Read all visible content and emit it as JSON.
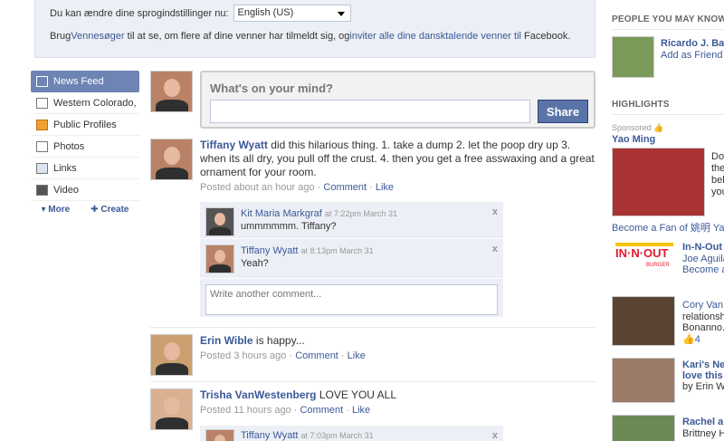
{
  "lang": {
    "label": "Du kan ændre dine sprogindstillinger nu:",
    "selected": "English (US)",
    "info_prefix": "Brug",
    "info_link1": "Vennesøger",
    "info_mid": " til at se, om flere af dine venner har tilmeldt sig, og",
    "info_link2": "inviter alle dine dansktalende venner til",
    "info_suffix": " Facebook."
  },
  "nav": {
    "items": [
      {
        "label": "News Feed",
        "icon": "news-feed-icon"
      },
      {
        "label": "Western Colorado, C",
        "icon": "network-icon"
      },
      {
        "label": "Public Profiles",
        "icon": "public-profiles-icon"
      },
      {
        "label": "Photos",
        "icon": "photos-icon"
      },
      {
        "label": "Links",
        "icon": "links-icon"
      },
      {
        "label": "Video",
        "icon": "video-icon"
      }
    ],
    "more": "▾ More",
    "create": "✚ Create"
  },
  "composer": {
    "prompt": "What's on your mind?",
    "share": "Share"
  },
  "stories": [
    {
      "actor": "Tiffany Wyatt",
      "text": " did this hilarious thing. 1. take a dump 2. let the poop dry up 3. when its all dry, you pull off the crust. 4. then you get a free asswaxing and a great ornament for your room.",
      "time": "Posted about an hour ago",
      "comment": "Comment",
      "like": "Like"
    },
    {
      "actor": "Erin Wible",
      "text": " is happy...",
      "time": "Posted 3 hours ago",
      "comment": "Comment",
      "like": "Like"
    },
    {
      "actor": "Trisha VanWestenberg",
      "text": " LOVE YOU ALL",
      "time": "Posted 11 hours ago",
      "comment": "Comment",
      "like": "Like"
    }
  ],
  "comments": [
    {
      "name": "Kit Maria Markgraf",
      "time": "at 7:22pm March 31",
      "text": "ummmmmm. Tiffany?"
    },
    {
      "name": "Tiffany Wyatt",
      "time": "at 8:13pm March 31",
      "text": "Yeah?"
    }
  ],
  "comments2": [
    {
      "name": "Tiffany Wyatt",
      "time": "at 7:03pm March 31"
    }
  ],
  "write_comment_placeholder": "Write another comment...",
  "right": {
    "pymk_title": "PEOPLE YOU MAY KNOW",
    "pymk_name": "Ricardo J. Bac",
    "pymk_add": "Add as Friend",
    "highlights_title": "HIGHLIGHTS",
    "sponsored": "Sponsored",
    "yao_name": "Yao Ming",
    "yao_text": [
      "Do",
      "the",
      "bel",
      "you"
    ],
    "yao_fan": "Become a Fan of 姚明 Yao M",
    "innout_name": "In-N-Out",
    "innout_sub1": "Joe Aguila",
    "innout_sub2": "Become a",
    "innout_logo_top": "IN·N·OUT",
    "innout_logo_bottom": "BURGER",
    "cory_line1": "Cory Van",
    "cory_line2": "relationshi",
    "cory_line3": "Bonanno.",
    "cory_likes": "4",
    "kari_line1": "Kari's Nev",
    "kari_line2": "love this",
    "kari_line3": "by Erin Wil",
    "rachel_line1": "Rachel a",
    "rachel_line2": "Brittney H"
  }
}
